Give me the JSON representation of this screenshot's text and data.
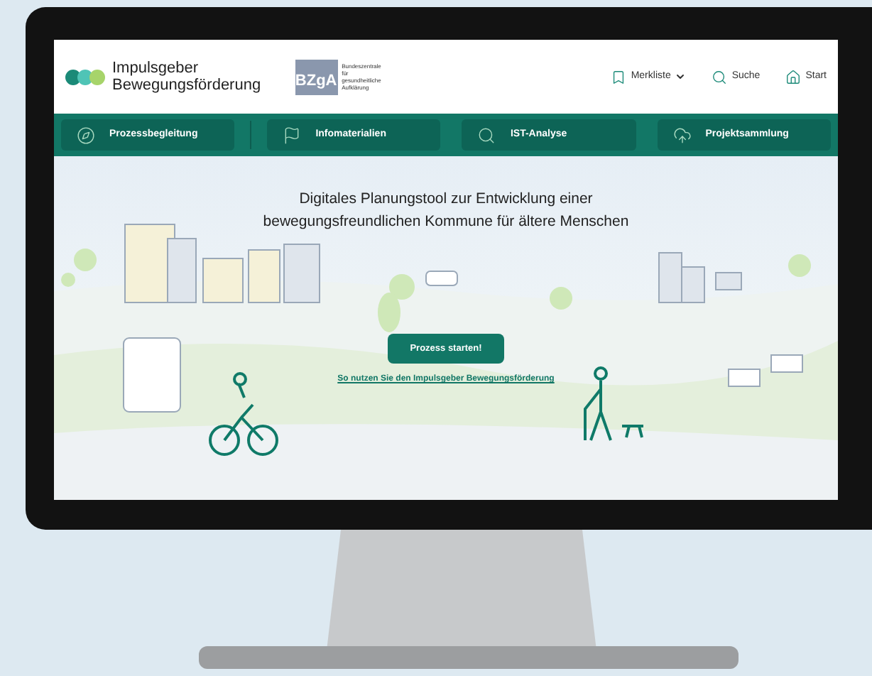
{
  "logo": {
    "line_1": "Impulsgeber",
    "line_2": "Bewegungsförderung"
  },
  "partner_logo": {
    "abbr": "BZgA",
    "lines": [
      "Bundeszentrale",
      "für",
      "gesundheitliche",
      "Aufklärung"
    ]
  },
  "header_links": [
    {
      "kind": "bookmark",
      "label": "Merkliste",
      "dropdown": true
    },
    {
      "kind": "search",
      "label": "Suche",
      "dropdown": false
    },
    {
      "kind": "home",
      "label": "Start",
      "dropdown": false
    }
  ],
  "nav": [
    {
      "kind": "compass",
      "label": "Prozessbegleitung"
    },
    {
      "kind": "flag",
      "label": "Infomaterialien"
    },
    {
      "kind": "search",
      "label": "IST-Analyse"
    },
    {
      "kind": "cloud",
      "label": "Projektsammlung"
    }
  ],
  "hero": {
    "title_line_1": "Digitales Planungstool zur Entwicklung einer",
    "title_line_2": "bewegungsfreundlichen Kommune für ältere Menschen",
    "button": "Prozess starten!",
    "link": "So nutzen Sie den Impulsgeber Bewegungsförderung"
  }
}
